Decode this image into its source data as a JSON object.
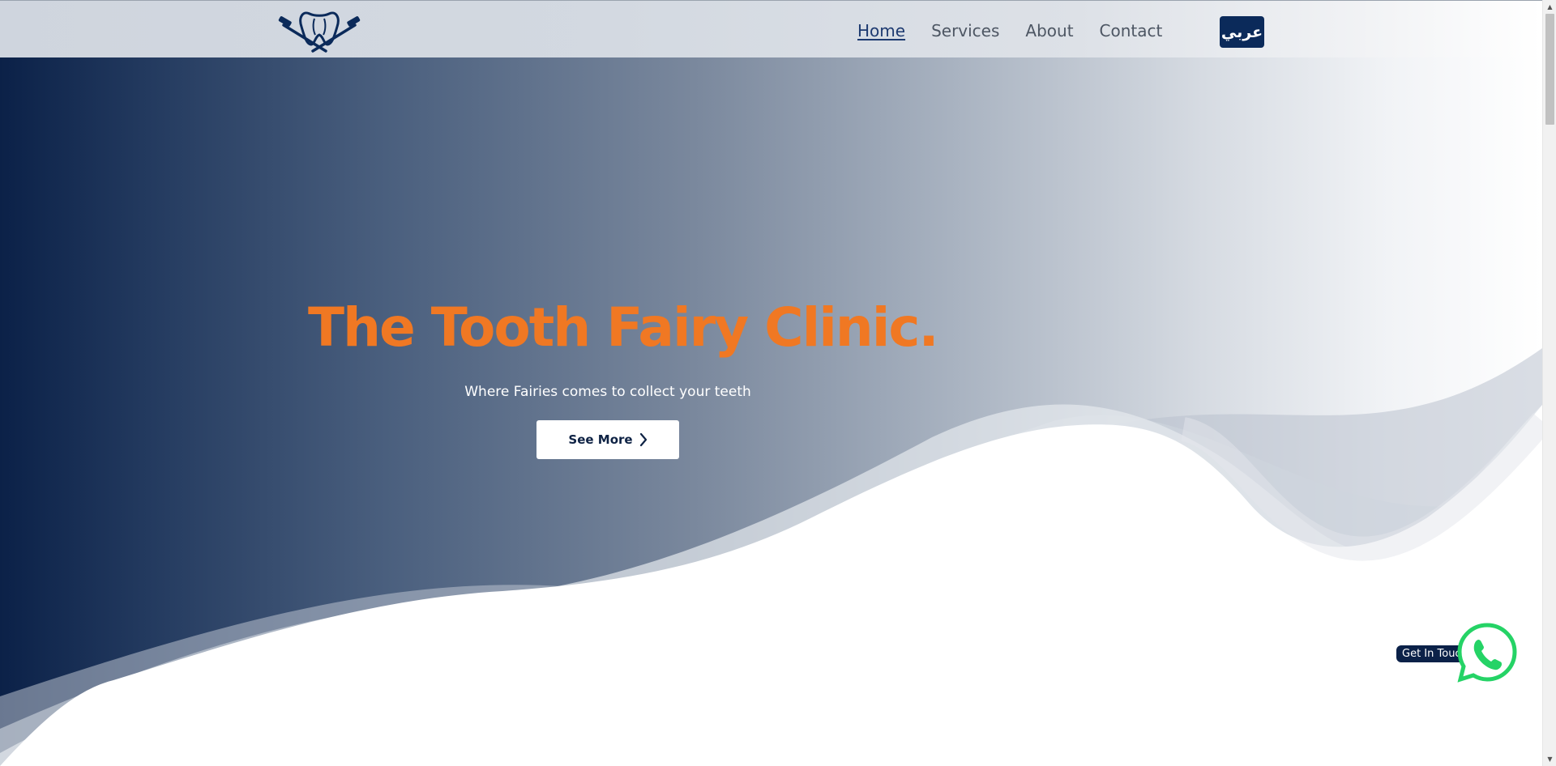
{
  "nav": {
    "items": [
      {
        "label": "Home",
        "active": true
      },
      {
        "label": "Services",
        "active": false
      },
      {
        "label": "About",
        "active": false
      },
      {
        "label": "Contact",
        "active": false
      }
    ],
    "language_button": "عربي"
  },
  "hero": {
    "title": "The Tooth Fairy Clinic.",
    "subtitle": "Where Fairies comes to collect your teeth",
    "cta_label": "See More"
  },
  "whatsapp": {
    "label": "Get In Touch"
  },
  "colors": {
    "brand_navy": "#0b2a5a",
    "accent_orange": "#f07823",
    "whatsapp_green": "#25d366"
  },
  "icons": {
    "logo": "tooth-with-toothbrushes-logo",
    "cta": "chevron-right-icon",
    "whatsapp": "whatsapp-icon"
  }
}
